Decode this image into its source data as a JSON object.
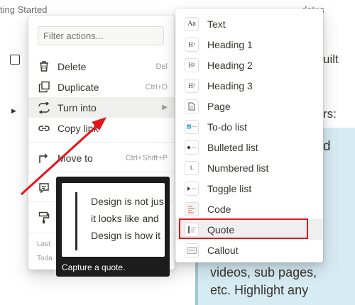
{
  "background": {
    "top_left_text": "ting Started",
    "top_right_text": "dates",
    "text_uilt": "uilt",
    "text_rs": "rs:",
    "text_d": "d",
    "callout_line_1": "videos, sub pages,",
    "callout_line_2": "etc. Highlight any"
  },
  "action_menu": {
    "filter_placeholder": "Filter actions...",
    "items": [
      {
        "label": "Delete",
        "shortcut": "Del",
        "icon": "trash-icon"
      },
      {
        "label": "Duplicate",
        "shortcut": "Ctrl+D",
        "icon": "duplicate-icon"
      },
      {
        "label": "Turn into",
        "shortcut": "▶",
        "icon": "turn-into-icon"
      },
      {
        "label": "Copy link",
        "shortcut": "",
        "icon": "link-icon"
      },
      {
        "label": "Move to",
        "shortcut": "Ctrl+Shift+P",
        "icon": "move-to-icon"
      },
      {
        "label": "",
        "shortcut": "",
        "icon": "comment-icon"
      },
      {
        "label": "",
        "shortcut": "",
        "icon": "paint-roller-icon"
      }
    ],
    "footer_line_1": "Last",
    "footer_line_2": "Toda"
  },
  "preview": {
    "line_1": "Design is not jus",
    "line_2": "it looks like and",
    "line_3": "Design is how it",
    "caption": "Capture a quote."
  },
  "submenu": {
    "items": [
      {
        "label": "Text",
        "thumb": "Aa"
      },
      {
        "label": "Heading 1",
        "thumb": "H1"
      },
      {
        "label": "Heading 2",
        "thumb": "H2"
      },
      {
        "label": "Heading 3",
        "thumb": "H3"
      },
      {
        "label": "Page",
        "thumb": "page-icon"
      },
      {
        "label": "To-do list",
        "thumb": "checkbox-icon"
      },
      {
        "label": "Bulleted list",
        "thumb": "bullet-icon"
      },
      {
        "label": "Numbered list",
        "thumb": "1."
      },
      {
        "label": "Toggle list",
        "thumb": "toggle-icon"
      },
      {
        "label": "Code",
        "thumb": "code-icon"
      },
      {
        "label": "Quote",
        "thumb": "quote-icon"
      },
      {
        "label": "Callout",
        "thumb": "callout-icon"
      }
    ]
  },
  "annotation": {
    "highlight_color": "#e8141a",
    "arrow_color": "#e8141a"
  },
  "colors": {
    "hover": "#efefee",
    "callout_bg": "#d7ebf3",
    "tooltip_bg": "#1d1d1d"
  }
}
